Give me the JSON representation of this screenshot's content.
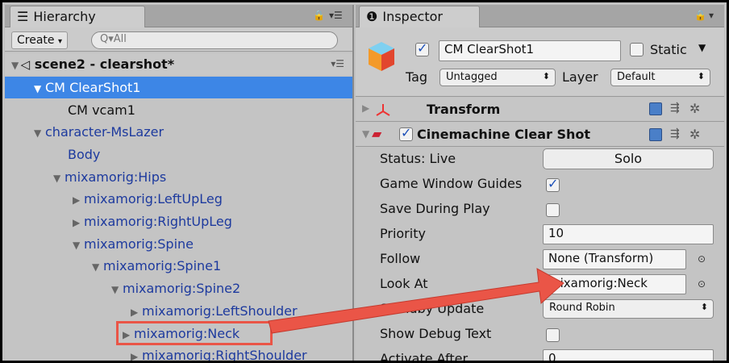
{
  "hierarchy": {
    "tab_label": "Hierarchy",
    "tab_icon": "list-icon",
    "create_label": "Create",
    "search_placeholder": "Q▾All",
    "scene_label": "scene2 - clearshot*",
    "items": [
      {
        "label": "CM ClearShot1",
        "expanded": true
      },
      {
        "label": "CM vcam1"
      },
      {
        "label": "character-MsLazer",
        "expanded": true
      },
      {
        "label": "Body"
      },
      {
        "label": "mixamorig:Hips",
        "expanded": true
      },
      {
        "label": "mixamorig:LeftUpLeg",
        "expanded": false
      },
      {
        "label": "mixamorig:RightUpLeg",
        "expanded": false
      },
      {
        "label": "mixamorig:Spine",
        "expanded": true
      },
      {
        "label": "mixamorig:Spine1",
        "expanded": true
      },
      {
        "label": "mixamorig:Spine2",
        "expanded": true
      },
      {
        "label": "mixamorig:LeftShoulder",
        "expanded": false
      },
      {
        "label": "mixamorig:Neck",
        "expanded": false
      },
      {
        "label": "mixamorig:RightShoulder",
        "expanded": false
      }
    ]
  },
  "inspector": {
    "tab_label": "Inspector",
    "tab_icon": "info-icon",
    "object_name": "CM ClearShot1",
    "static_label": "Static",
    "tag_label": "Tag",
    "tag_value": "Untagged",
    "layer_label": "Layer",
    "layer_value": "Default",
    "transform_title": "Transform",
    "component_title": "Cinemachine Clear Shot",
    "props": {
      "status_label": "Status: Live",
      "solo_label": "Solo",
      "game_window_guides": "Game Window Guides",
      "save_during_play": "Save During Play",
      "priority_label": "Priority",
      "priority_value": "10",
      "follow_label": "Follow",
      "follow_value": "None (Transform)",
      "look_at_label": "Look At",
      "look_at_value": "mixamorig:Neck",
      "standby_label": "Standby Update",
      "standby_value": "Round Robin",
      "show_debug_label": "Show Debug Text",
      "activate_after_label": "Activate After",
      "activate_after_value": "0"
    }
  },
  "annotation": {
    "color": "#ea5547"
  }
}
